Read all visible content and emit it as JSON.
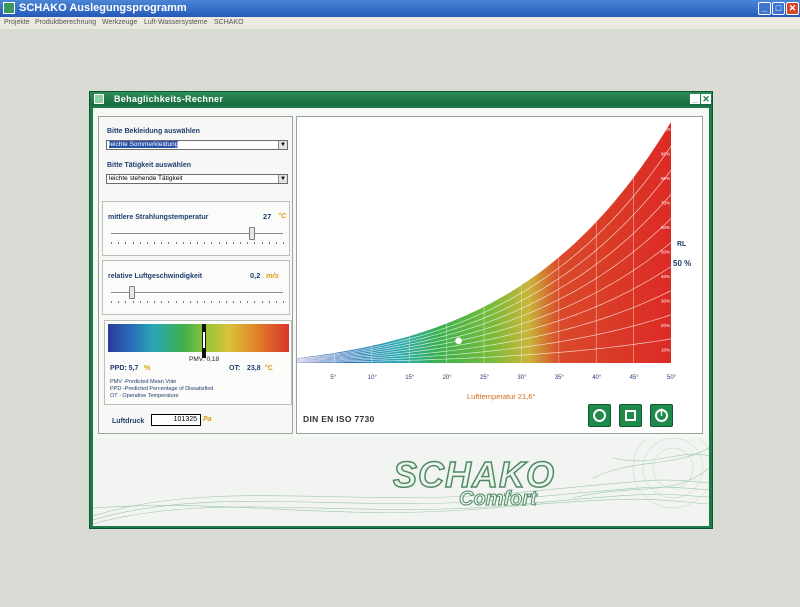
{
  "app": {
    "title": "SCHAKO Auslegungsprogramm",
    "menu": [
      "Projekte",
      "Produktberechnung",
      "Werkzeuge",
      "Luft-Wassersysteme",
      "SCHAKO"
    ]
  },
  "dialog": {
    "title": "Behaglichkeits-Rechner",
    "clothing": {
      "label": "Bitte Bekleidung auswählen",
      "value": "leichte Sommerkleidung"
    },
    "activity": {
      "label": "Bitte Tätigkeit auswählen",
      "value": "leichte stehende Tätigkeit"
    },
    "radiant": {
      "label": "mittlere Strahlungstemperatur",
      "value": "27",
      "unit": "°C",
      "level": 0.82
    },
    "airspeed": {
      "label": "relative Luftgeschwindigkeit",
      "value": "0,2",
      "unit": "m/s",
      "level": 0.12
    },
    "comfort": {
      "pmv_label": "PMV: 0,18",
      "pmv_level": 0.53,
      "ppd_label": "PPD: 5,7",
      "ppd_unit": "%",
      "ot_label": "OT:",
      "ot_value": "23,8",
      "ot_unit": "°C",
      "legend": [
        "PMV -Predicted Mean Vote",
        "PPD -Predicted Percentage of Dissatisfied",
        "OT - Operative Temperature"
      ]
    },
    "pressure": {
      "label": "Luftdruck",
      "value": "101325",
      "unit": "Pa"
    },
    "chart": {
      "rl_label": "RL",
      "rl_value": "50 %",
      "x_ticks": [
        "5°",
        "10°",
        "15°",
        "20°",
        "25°",
        "30°",
        "35°",
        "40°",
        "45°",
        "50°"
      ],
      "rh_ticks": [
        "100%",
        "90%",
        "80%",
        "70%",
        "60%",
        "50%",
        "40%",
        "30%",
        "20%",
        "10%"
      ],
      "x_title": "Lufttemperatur  21,6°",
      "point": {
        "temp": 21.6,
        "rh": 50
      }
    },
    "standard": "DIN EN ISO 7730",
    "buttons": {
      "reset": "reset-icon",
      "print": "print-icon",
      "info": "info-icon"
    },
    "brand": {
      "name": "SCHAKO",
      "sub": "Comfort"
    }
  },
  "colors": {
    "dialog_green": "#1e7a4a",
    "accent_orange": "#d7a114",
    "label_blue": "#1f3e6e"
  }
}
